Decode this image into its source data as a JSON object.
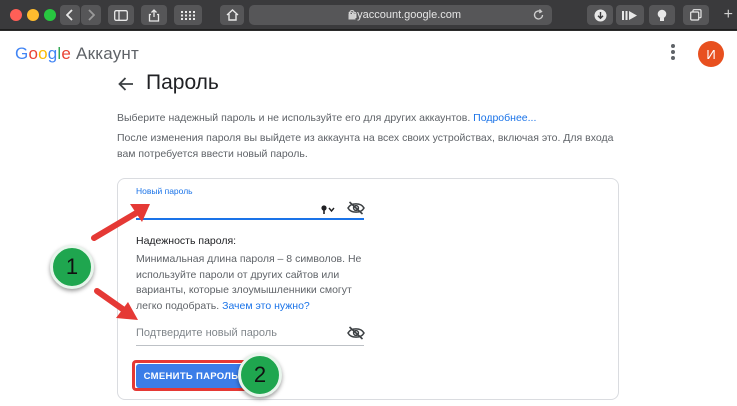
{
  "browser": {
    "url": "myaccount.google.com"
  },
  "header": {
    "brand_letters": [
      "G",
      "o",
      "o",
      "g",
      "l",
      "e"
    ],
    "product": "Аккаунт",
    "avatar_letter": "И"
  },
  "main": {
    "title": "Пароль",
    "intro_text": "Выберите надежный пароль и не используйте его для других аккаунтов.",
    "intro_link": "Подробнее...",
    "logout_note": "После изменения пароля вы выйдете из аккаунта на всех своих устройствах, включая это. Для входа вам потребуется ввести новый пароль."
  },
  "form": {
    "new_password_label": "Новый пароль",
    "strength_title": "Надежность пароля:",
    "strength_text": "Минимальная длина пароля – 8 символов. Не используйте пароли от других сайтов или варианты, которые злоумышленники смогут легко подобрать.",
    "strength_link": "Зачем это нужно?",
    "confirm_placeholder": "Подтвердите новый пароль",
    "submit_label": "СМЕНИТЬ ПАРОЛЬ"
  },
  "annotations": {
    "step1": "1",
    "step2": "2"
  },
  "colors": {
    "accent": "#1a73e8",
    "button": "#3b7de8",
    "highlight": "#e53935",
    "badge": "#1fa64f",
    "avatar": "#e8501f"
  }
}
